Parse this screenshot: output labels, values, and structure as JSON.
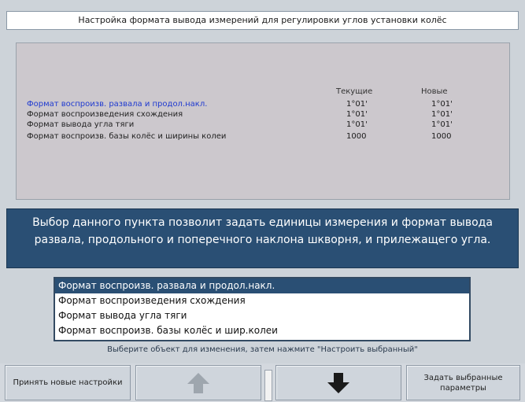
{
  "title": "Настройка формата вывода измерений для регулировки углов установки колёс",
  "settings": {
    "columns": [
      "Текущие",
      "Новые"
    ],
    "rows": [
      {
        "label": "Формат воспроизв. развала и продол.накл.",
        "current": "1°01'",
        "new": "1°01'"
      },
      {
        "label": "Формат воспроизведения схождения",
        "current": "1°01'",
        "new": "1°01'"
      },
      {
        "label": "Формат вывода угла тяги",
        "current": "1°01'",
        "new": "1°01'"
      },
      {
        "label": "Формат воспроизв. базы колёс и ширины колеи",
        "current": "1000",
        "new": "1000"
      }
    ]
  },
  "description": "Выбор данного пункта позволит задать единицы измерения и формат вывода развала, продольного и поперечного наклона шкворня, и прилежащего угла.",
  "list": {
    "items": [
      {
        "text": "Формат воспроизв. развала и продол.накл.",
        "selected": true
      },
      {
        "text": "Формат воспроизведения схождения",
        "selected": false
      },
      {
        "text": "Формат вывода угла тяги",
        "selected": false
      },
      {
        "text": "Формат воспроизв. базы колёс и шир.колеи",
        "selected": false
      }
    ]
  },
  "hint": "Выберите объект для изменения, затем нажмите \"Настроить выбранный\"",
  "buttons": {
    "left": "Принять новые настройки",
    "up_icon": "arrow-up-icon",
    "down_icon": "arrow-down-icon",
    "right": "Задать выбранные параметры"
  }
}
